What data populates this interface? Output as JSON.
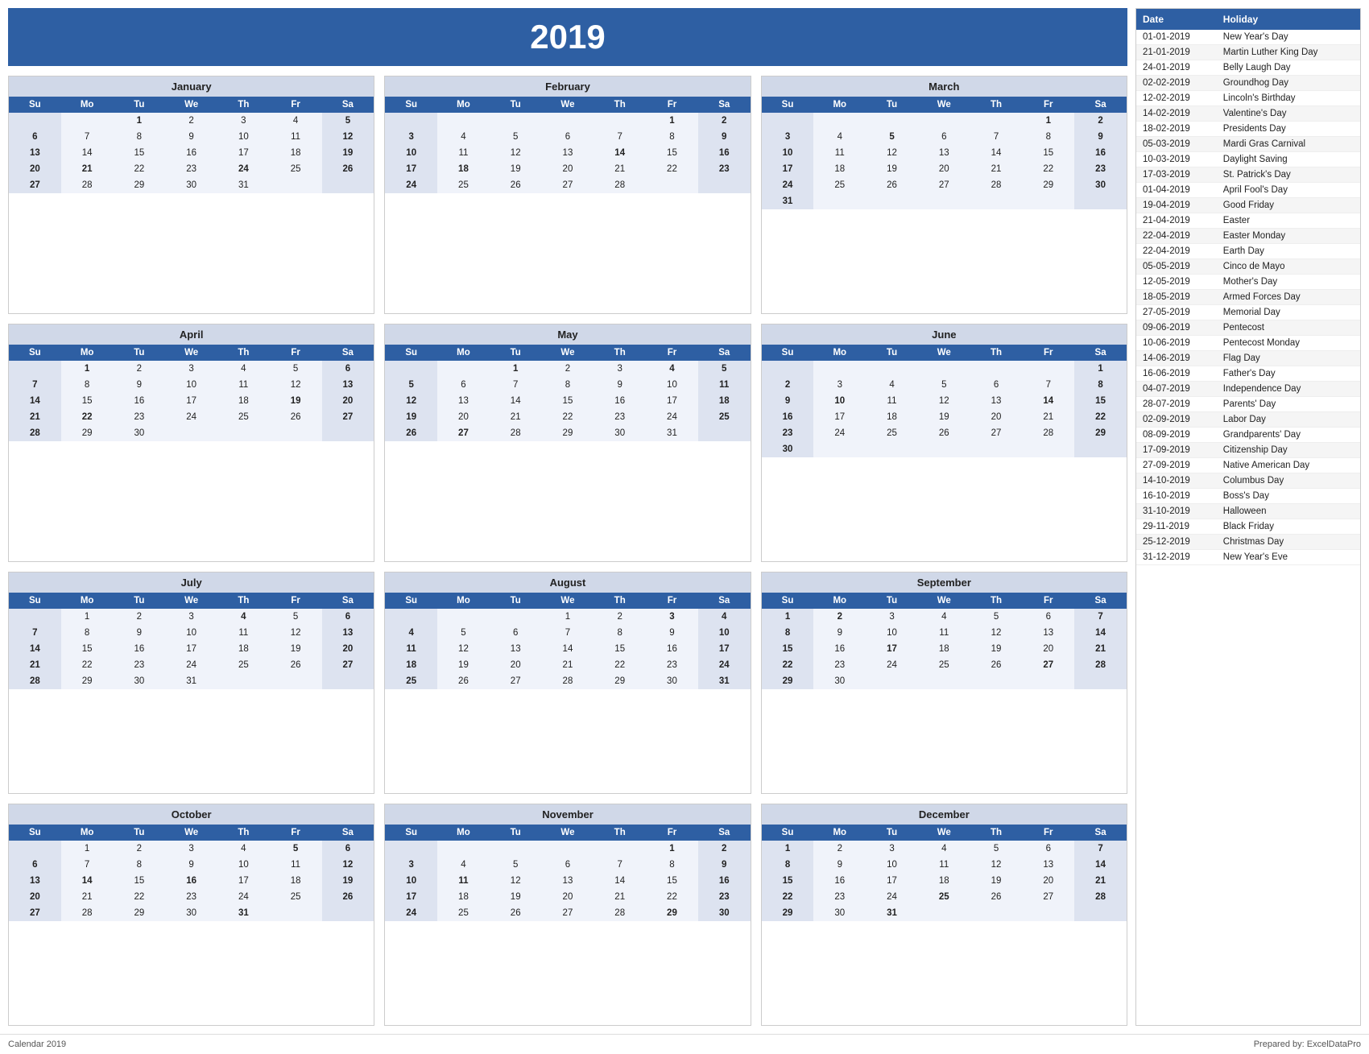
{
  "year": "2019",
  "footer": {
    "left": "Calendar 2019",
    "right": "Prepared by: ExcelDataPro"
  },
  "months": [
    {
      "name": "January",
      "weeks": [
        [
          "",
          "",
          "1",
          "2",
          "3",
          "4",
          "5"
        ],
        [
          "6",
          "7",
          "8",
          "9",
          "10",
          "11",
          "12"
        ],
        [
          "13",
          "14",
          "15",
          "16",
          "17",
          "18",
          "19"
        ],
        [
          "20",
          "21",
          "22",
          "23",
          "24",
          "25",
          "26"
        ],
        [
          "27",
          "28",
          "29",
          "30",
          "31",
          "",
          ""
        ]
      ],
      "bold": [
        "1",
        "5",
        "6",
        "12",
        "13",
        "19",
        "20",
        "21",
        "24",
        "26",
        "27"
      ]
    },
    {
      "name": "February",
      "weeks": [
        [
          "",
          "",
          "",
          "",
          "",
          "1",
          "2"
        ],
        [
          "3",
          "4",
          "5",
          "6",
          "7",
          "8",
          "9"
        ],
        [
          "10",
          "11",
          "12",
          "13",
          "14",
          "15",
          "16"
        ],
        [
          "17",
          "18",
          "19",
          "20",
          "21",
          "22",
          "23"
        ],
        [
          "24",
          "25",
          "26",
          "27",
          "28",
          "",
          ""
        ]
      ],
      "bold": [
        "1",
        "2",
        "3",
        "9",
        "10",
        "14",
        "16",
        "17",
        "18",
        "23",
        "24"
      ]
    },
    {
      "name": "March",
      "weeks": [
        [
          "",
          "",
          "",
          "",
          "",
          "1",
          "2"
        ],
        [
          "3",
          "4",
          "5",
          "6",
          "7",
          "8",
          "9"
        ],
        [
          "10",
          "11",
          "12",
          "13",
          "14",
          "15",
          "16"
        ],
        [
          "17",
          "18",
          "19",
          "20",
          "21",
          "22",
          "23"
        ],
        [
          "24",
          "25",
          "26",
          "27",
          "28",
          "29",
          "30"
        ],
        [
          "31",
          "",
          "",
          "",
          "",
          "",
          ""
        ]
      ],
      "bold": [
        "1",
        "2",
        "3",
        "5",
        "9",
        "10",
        "16",
        "17",
        "23",
        "24",
        "30",
        "31"
      ]
    },
    {
      "name": "April",
      "weeks": [
        [
          "",
          "1",
          "2",
          "3",
          "4",
          "5",
          "6"
        ],
        [
          "7",
          "8",
          "9",
          "10",
          "11",
          "12",
          "13"
        ],
        [
          "14",
          "15",
          "16",
          "17",
          "18",
          "19",
          "20"
        ],
        [
          "21",
          "22",
          "23",
          "24",
          "25",
          "26",
          "27"
        ],
        [
          "28",
          "29",
          "30",
          "",
          "",
          "",
          ""
        ]
      ],
      "bold": [
        "1",
        "6",
        "7",
        "13",
        "14",
        "19",
        "20",
        "21",
        "22",
        "27",
        "28"
      ]
    },
    {
      "name": "May",
      "weeks": [
        [
          "",
          "",
          "1",
          "2",
          "3",
          "4",
          "5"
        ],
        [
          "5",
          "6",
          "7",
          "8",
          "9",
          "10",
          "11"
        ],
        [
          "12",
          "13",
          "14",
          "15",
          "16",
          "17",
          "18"
        ],
        [
          "19",
          "20",
          "21",
          "22",
          "23",
          "24",
          "25"
        ],
        [
          "26",
          "27",
          "28",
          "29",
          "30",
          "31",
          ""
        ]
      ],
      "bold": [
        "1",
        "4",
        "5",
        "11",
        "12",
        "18",
        "19",
        "25",
        "26",
        "27"
      ]
    },
    {
      "name": "June",
      "weeks": [
        [
          "",
          "",
          "",
          "",
          "",
          "",
          "1"
        ],
        [
          "2",
          "3",
          "4",
          "5",
          "6",
          "7",
          "8"
        ],
        [
          "9",
          "10",
          "11",
          "12",
          "13",
          "14",
          "15"
        ],
        [
          "16",
          "17",
          "18",
          "19",
          "20",
          "21",
          "22"
        ],
        [
          "23",
          "24",
          "25",
          "26",
          "27",
          "28",
          "29"
        ],
        [
          "30",
          "",
          "",
          "",
          "",
          "",
          ""
        ]
      ],
      "bold": [
        "1",
        "2",
        "8",
        "9",
        "10",
        "14",
        "15",
        "16",
        "22",
        "23",
        "29",
        "30"
      ]
    },
    {
      "name": "July",
      "weeks": [
        [
          "",
          "1",
          "2",
          "3",
          "4",
          "5",
          "6"
        ],
        [
          "7",
          "8",
          "9",
          "10",
          "11",
          "12",
          "13"
        ],
        [
          "14",
          "15",
          "16",
          "17",
          "18",
          "19",
          "20"
        ],
        [
          "21",
          "22",
          "23",
          "24",
          "25",
          "26",
          "27"
        ],
        [
          "28",
          "29",
          "30",
          "31",
          "",
          "",
          ""
        ]
      ],
      "bold": [
        "4",
        "6",
        "7",
        "13",
        "14",
        "20",
        "21",
        "27",
        "28"
      ]
    },
    {
      "name": "August",
      "weeks": [
        [
          "",
          "",
          "",
          "1",
          "2",
          "3",
          "4"
        ],
        [
          "4",
          "5",
          "6",
          "7",
          "8",
          "9",
          "10"
        ],
        [
          "11",
          "12",
          "13",
          "14",
          "15",
          "16",
          "17"
        ],
        [
          "18",
          "19",
          "20",
          "21",
          "22",
          "23",
          "24"
        ],
        [
          "25",
          "26",
          "27",
          "28",
          "29",
          "30",
          "31"
        ]
      ],
      "bold": [
        "3",
        "4",
        "10",
        "11",
        "17",
        "18",
        "24",
        "25",
        "31"
      ]
    },
    {
      "name": "September",
      "weeks": [
        [
          "1",
          "2",
          "3",
          "4",
          "5",
          "6",
          "7"
        ],
        [
          "8",
          "9",
          "10",
          "11",
          "12",
          "13",
          "14"
        ],
        [
          "15",
          "16",
          "17",
          "18",
          "19",
          "20",
          "21"
        ],
        [
          "22",
          "23",
          "24",
          "25",
          "26",
          "27",
          "28"
        ],
        [
          "29",
          "30",
          "",
          "",
          "",
          "",
          ""
        ]
      ],
      "bold": [
        "1",
        "2",
        "7",
        "8",
        "14",
        "15",
        "17",
        "21",
        "22",
        "27",
        "28",
        "29"
      ]
    },
    {
      "name": "October",
      "weeks": [
        [
          "",
          "1",
          "2",
          "3",
          "4",
          "5",
          "6"
        ],
        [
          "6",
          "7",
          "8",
          "9",
          "10",
          "11",
          "12"
        ],
        [
          "13",
          "14",
          "15",
          "16",
          "17",
          "18",
          "19"
        ],
        [
          "20",
          "21",
          "22",
          "23",
          "24",
          "25",
          "26"
        ],
        [
          "27",
          "28",
          "29",
          "30",
          "31",
          "",
          ""
        ]
      ],
      "bold": [
        "5",
        "6",
        "12",
        "13",
        "14",
        "16",
        "19",
        "20",
        "26",
        "27",
        "31"
      ]
    },
    {
      "name": "November",
      "weeks": [
        [
          "",
          "",
          "",
          "",
          "",
          "1",
          "2"
        ],
        [
          "3",
          "4",
          "5",
          "6",
          "7",
          "8",
          "9"
        ],
        [
          "10",
          "11",
          "12",
          "13",
          "14",
          "15",
          "16"
        ],
        [
          "17",
          "18",
          "19",
          "20",
          "21",
          "22",
          "23"
        ],
        [
          "24",
          "25",
          "26",
          "27",
          "28",
          "29",
          "30"
        ]
      ],
      "bold": [
        "1",
        "2",
        "3",
        "9",
        "10",
        "11",
        "16",
        "17",
        "23",
        "24",
        "29",
        "30"
      ]
    },
    {
      "name": "December",
      "weeks": [
        [
          "1",
          "2",
          "3",
          "4",
          "5",
          "6",
          "7"
        ],
        [
          "8",
          "9",
          "10",
          "11",
          "12",
          "13",
          "14"
        ],
        [
          "15",
          "16",
          "17",
          "18",
          "19",
          "20",
          "21"
        ],
        [
          "22",
          "23",
          "24",
          "25",
          "26",
          "27",
          "28"
        ],
        [
          "29",
          "30",
          "31",
          "",
          "",
          "",
          ""
        ]
      ],
      "bold": [
        "1",
        "7",
        "8",
        "14",
        "15",
        "21",
        "22",
        "25",
        "28",
        "29",
        "31"
      ]
    }
  ],
  "day_headers": [
    "Su",
    "Mo",
    "Tu",
    "We",
    "Th",
    "Fr",
    "Sa"
  ],
  "holidays": {
    "header": [
      "Date",
      "Holiday"
    ],
    "rows": [
      [
        "01-01-2019",
        "New Year's Day"
      ],
      [
        "21-01-2019",
        "Martin Luther King Day"
      ],
      [
        "24-01-2019",
        "Belly Laugh Day"
      ],
      [
        "02-02-2019",
        "Groundhog Day"
      ],
      [
        "12-02-2019",
        "Lincoln's Birthday"
      ],
      [
        "14-02-2019",
        "Valentine's Day"
      ],
      [
        "18-02-2019",
        "Presidents Day"
      ],
      [
        "05-03-2019",
        "Mardi Gras Carnival"
      ],
      [
        "10-03-2019",
        "Daylight Saving"
      ],
      [
        "17-03-2019",
        "St. Patrick's Day"
      ],
      [
        "01-04-2019",
        "April Fool's Day"
      ],
      [
        "19-04-2019",
        "Good Friday"
      ],
      [
        "21-04-2019",
        "Easter"
      ],
      [
        "22-04-2019",
        "Easter Monday"
      ],
      [
        "22-04-2019",
        "Earth Day"
      ],
      [
        "05-05-2019",
        "Cinco de Mayo"
      ],
      [
        "12-05-2019",
        "Mother's Day"
      ],
      [
        "18-05-2019",
        "Armed Forces Day"
      ],
      [
        "27-05-2019",
        "Memorial Day"
      ],
      [
        "09-06-2019",
        "Pentecost"
      ],
      [
        "10-06-2019",
        "Pentecost Monday"
      ],
      [
        "14-06-2019",
        "Flag Day"
      ],
      [
        "16-06-2019",
        "Father's Day"
      ],
      [
        "04-07-2019",
        "Independence Day"
      ],
      [
        "28-07-2019",
        "Parents' Day"
      ],
      [
        "02-09-2019",
        "Labor Day"
      ],
      [
        "08-09-2019",
        "Grandparents' Day"
      ],
      [
        "17-09-2019",
        "Citizenship Day"
      ],
      [
        "27-09-2019",
        "Native American Day"
      ],
      [
        "14-10-2019",
        "Columbus Day"
      ],
      [
        "16-10-2019",
        "Boss's Day"
      ],
      [
        "31-10-2019",
        "Halloween"
      ],
      [
        "29-11-2019",
        "Black Friday"
      ],
      [
        "25-12-2019",
        "Christmas Day"
      ],
      [
        "31-12-2019",
        "New Year's Eve"
      ]
    ]
  }
}
